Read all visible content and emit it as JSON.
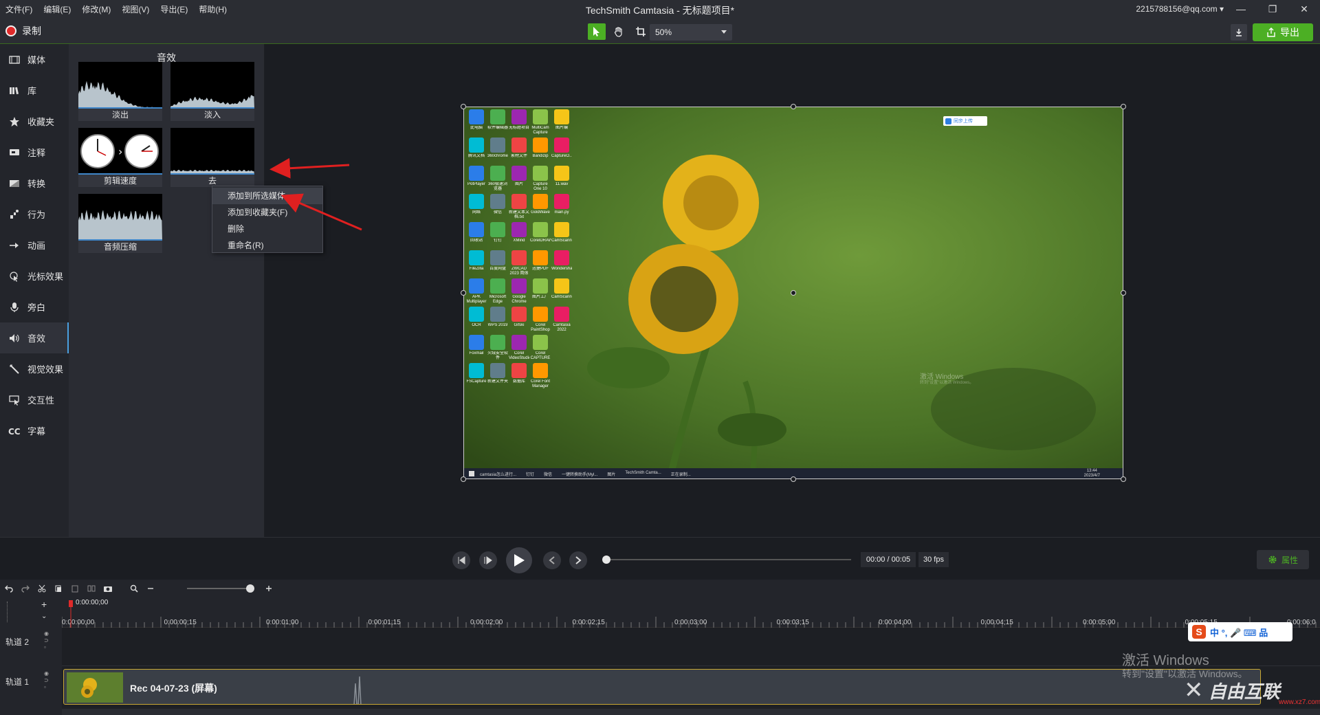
{
  "menu": [
    "文件(F)",
    "编辑(E)",
    "修改(M)",
    "视图(V)",
    "导出(E)",
    "帮助(H)"
  ],
  "app_title": "TechSmith Camtasia - 无标题项目*",
  "account": "2215788156@qq.com ▾",
  "record_label": "录制",
  "zoom_value": "50%",
  "export_label": "导出",
  "sidebar": [
    {
      "label": "媒体",
      "icon": "film-icon"
    },
    {
      "label": "库",
      "icon": "library-icon"
    },
    {
      "label": "收藏夹",
      "icon": "star-icon"
    },
    {
      "label": "注释",
      "icon": "annotation-icon"
    },
    {
      "label": "转换",
      "icon": "transition-icon"
    },
    {
      "label": "行为",
      "icon": "behavior-icon"
    },
    {
      "label": "动画",
      "icon": "animation-icon"
    },
    {
      "label": "光标效果",
      "icon": "cursor-effect-icon"
    },
    {
      "label": "旁白",
      "icon": "microphone-icon"
    },
    {
      "label": "音效",
      "icon": "speaker-icon",
      "active": true
    },
    {
      "label": "视觉效果",
      "icon": "wand-icon"
    },
    {
      "label": "交互性",
      "icon": "interactive-icon"
    },
    {
      "label": "字幕",
      "icon": "cc-icon"
    }
  ],
  "panel": {
    "title": "音效",
    "tiles": [
      {
        "label": "淡出"
      },
      {
        "label": "淡入"
      },
      {
        "label": "剪辑速度"
      },
      {
        "label": "去"
      },
      {
        "label": "音频压缩"
      }
    ]
  },
  "context_menu": [
    "添加到所选媒体",
    "添加到收藏夹(F)",
    "删除",
    "重命名(R)"
  ],
  "preview": {
    "watermark_line1": "激活 Windows",
    "watermark_line2": "转到\"设置\"以激活 Windows。",
    "cloud_button": "同步上传",
    "taskbar_items": [
      "camtasia怎么进行...",
      "钉钉",
      "微信",
      "一键转换助手(Myl...",
      "图片",
      "TechSmith Camta...",
      "正在录制..."
    ],
    "taskbar_time": "13:44",
    "taskbar_date": "2023/4/7",
    "icons": [
      "此电脑",
      "软件编辑器",
      "无标题项目",
      "MultiCam Capture Lite",
      "图片编",
      "腾讯文档",
      "360chrome",
      "素材文件",
      "Bandizip",
      "CaptureO...",
      "PotPlayer",
      "360极速浏览器",
      "图片",
      "Capture One 10",
      "11.wav",
      "网络",
      "微信",
      "新建文本文档.txt",
      "GoldWave",
      "main.py",
      "回收站",
      "钉钉",
      "XMind",
      "CorelDRAW",
      "CamScanner",
      "FileZilla",
      "百度网盘",
      "ZWCAD 2023 简体",
      "迅捷PDF",
      "Wondershare",
      "APK Multiplayer",
      "Microsoft Edge",
      "Google Chrome",
      "图片工厂",
      "CamScanner",
      "OCR",
      "WPS 2019",
      "Gifski",
      "Corel PaintShop",
      "Camtasia 2022",
      "Foxmail",
      "火绒安全软件",
      "Corel VideoStudio",
      "Corel CAPTURE",
      "",
      "FSCapture",
      "新建文件夹",
      "数据库",
      "Corel Font Manager",
      ""
    ]
  },
  "playback": {
    "time": "00:00 / 00:05",
    "fps": "30 fps",
    "properties_label": "属性"
  },
  "timeline": {
    "playhead_time": "0:00:00;00",
    "ruler": [
      "0:00:00;00",
      "0:00:00;15",
      "0:00:01;00",
      "0:00:01;15",
      "0:00:02;00",
      "0:00:02;15",
      "0:00:03;00",
      "0:00:03;15",
      "0:00:04;00",
      "0:00:04;15",
      "0:00:05;00",
      "0:00:05;15",
      "0:00:06;0"
    ],
    "tracks": [
      "轨道 2",
      "轨道 1"
    ],
    "clip_label": "Rec 04-07-23 (屏幕)"
  },
  "overlay": {
    "watermark_line1": "激活 Windows",
    "watermark_line2": "转到\"设置\"以激活 Windows。",
    "ime": "中 °, 🎤 ⌨ 品",
    "site_logo": "自由互联",
    "site_url": "www.xz7.com"
  },
  "colors": {
    "accent_green": "#4caf24",
    "record_red": "#e02a2a",
    "clip_border": "#c9a832",
    "arrow_red": "#e02020"
  }
}
